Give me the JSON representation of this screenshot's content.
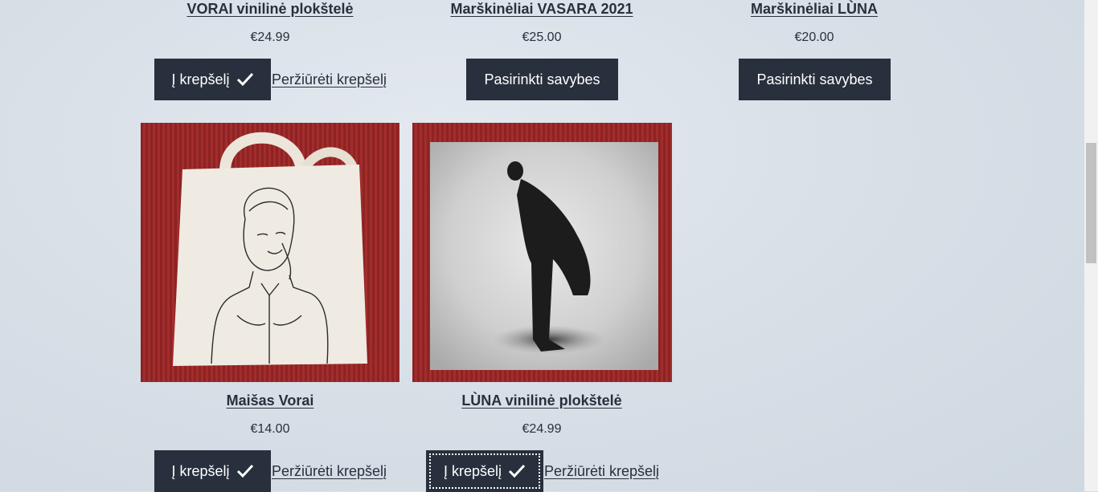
{
  "products": [
    {
      "title": "VORAI vinilinė plokštelė",
      "price": "€24.99",
      "button": "Į krepšelį",
      "view_cart": "Peržiūrėti krepšelį"
    },
    {
      "title": "Marškinėliai VASARA 2021",
      "price": "€25.00",
      "button": "Pasirinkti savybes"
    },
    {
      "title": "Marškinėliai LÙNA",
      "price": "€20.00",
      "button": "Pasirinkti savybes"
    },
    {
      "title": "Maišas Vorai",
      "price": "€14.00",
      "button": "Į krepšelį",
      "view_cart": "Peržiūrėti krepšelį"
    },
    {
      "title": "LÙNA vinilinė plokštelė",
      "price": "€24.99",
      "button": "Į krepšelį",
      "view_cart": "Peržiūrėti krepšelį"
    }
  ],
  "colors": {
    "button_bg": "#28303d",
    "text": "#28303d",
    "red_backdrop": "#9b2a2a"
  },
  "icons": {
    "added": "check-icon"
  }
}
